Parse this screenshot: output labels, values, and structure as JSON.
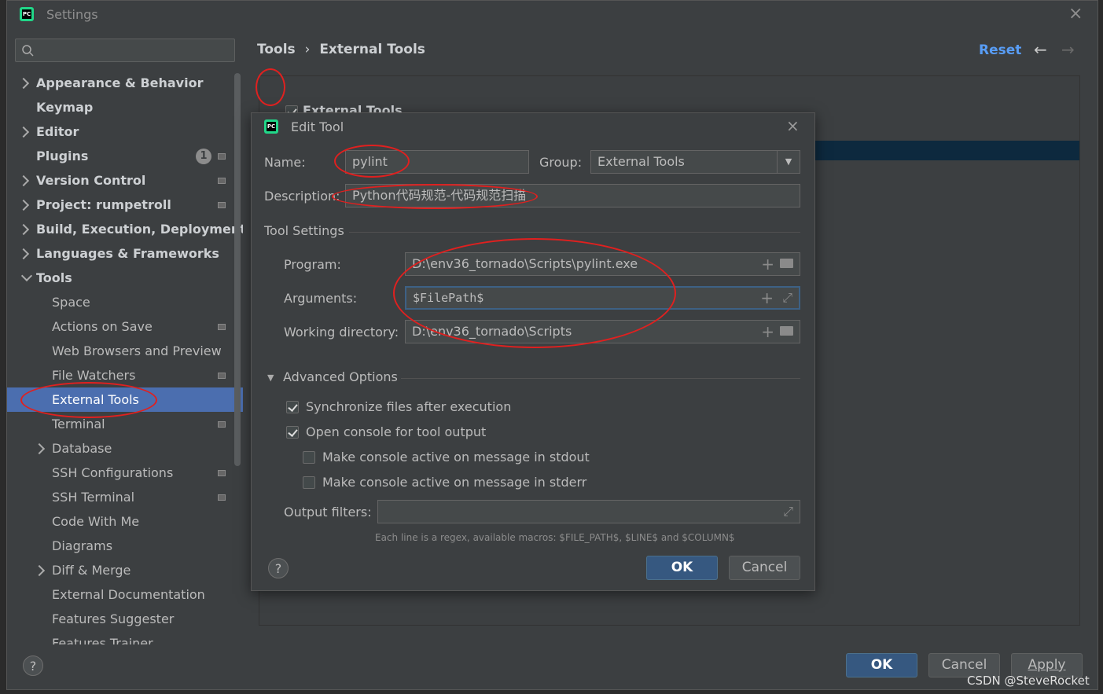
{
  "window": {
    "title": "Settings",
    "close": "×"
  },
  "search": {
    "placeholder": ""
  },
  "sidebar": {
    "items": [
      {
        "label": "Appearance & Behavior"
      },
      {
        "label": "Keymap"
      },
      {
        "label": "Editor"
      },
      {
        "label": "Plugins",
        "badge": "1"
      },
      {
        "label": "Version Control"
      },
      {
        "label": "Project: rumpetroll"
      },
      {
        "label": "Build, Execution, Deployment"
      },
      {
        "label": "Languages & Frameworks"
      },
      {
        "label": "Tools"
      },
      {
        "label": "Space"
      },
      {
        "label": "Actions on Save"
      },
      {
        "label": "Web Browsers and Preview"
      },
      {
        "label": "File Watchers"
      },
      {
        "label": "External Tools"
      },
      {
        "label": "Terminal"
      },
      {
        "label": "Database"
      },
      {
        "label": "SSH Configurations"
      },
      {
        "label": "SSH Terminal"
      },
      {
        "label": "Code With Me"
      },
      {
        "label": "Diagrams"
      },
      {
        "label": "Diff & Merge"
      },
      {
        "label": "External Documentation"
      },
      {
        "label": "Features Suggester"
      },
      {
        "label": "Features Trainer"
      }
    ]
  },
  "breadcrumb": {
    "parent": "Tools",
    "separator": "›",
    "current": "External Tools"
  },
  "header": {
    "reset": "Reset",
    "back": "←",
    "forward": "→"
  },
  "toolbar": {
    "add": "+",
    "remove": "−",
    "edit": "✎",
    "up": "▲",
    "down": "▼",
    "copy": "⧉"
  },
  "tree": {
    "group_label": "External Tools"
  },
  "dialog": {
    "title": "Edit Tool",
    "close": "×",
    "name_label": "Name:",
    "name_value": "pylint",
    "group_label": "Group:",
    "group_value": "External Tools",
    "description_label": "Description:",
    "description_value": "Python代码规范-代码规范扫描",
    "tool_settings": "Tool Settings",
    "program_label": "Program:",
    "program_value": "D:\\env36_tornado\\Scripts\\pylint.exe",
    "arguments_label": "Arguments:",
    "arguments_value": "$FilePath$",
    "workdir_label": "Working directory:",
    "workdir_value": "D:\\env36_tornado\\Scripts",
    "advanced_options": "Advanced Options",
    "sync_files": "Synchronize files after execution",
    "open_console": "Open console for tool output",
    "console_stdout": "Make console active on message in stdout",
    "console_stderr": "Make console active on message in stderr",
    "output_filters_label": "Output filters:",
    "output_filters_value": "",
    "hint": "Each line is a regex, available macros: $FILE_PATH$, $LINE$ and $COLUMN$",
    "ok": "OK",
    "cancel": "Cancel",
    "help": "?"
  },
  "footer": {
    "ok": "OK",
    "cancel": "Cancel",
    "apply": "Apply",
    "help": "?"
  },
  "watermark": "CSDN @SteveRocket"
}
